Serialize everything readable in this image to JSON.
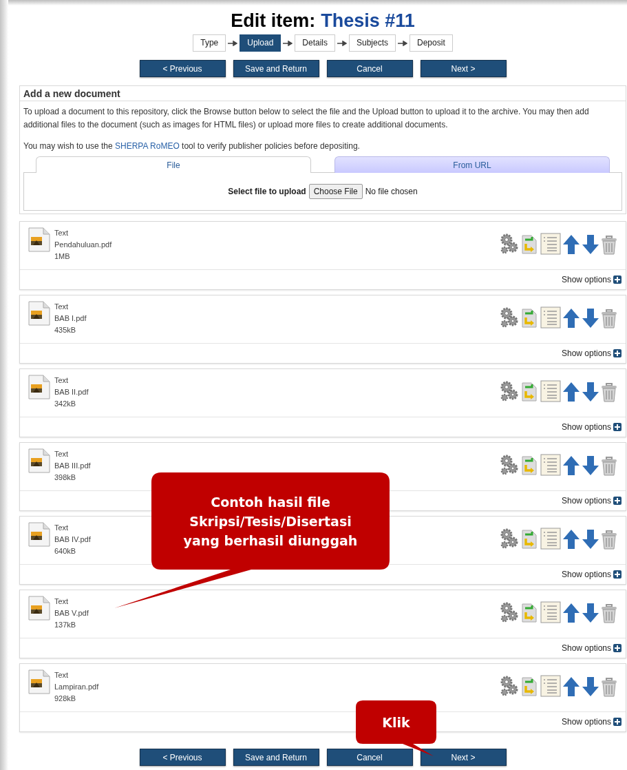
{
  "title": {
    "prefix": "Edit item:",
    "name": "Thesis #11"
  },
  "steps": [
    {
      "label": "Type",
      "selected": false
    },
    {
      "label": "Upload",
      "selected": true
    },
    {
      "label": "Details",
      "selected": false
    },
    {
      "label": "Subjects",
      "selected": false
    },
    {
      "label": "Deposit",
      "selected": false
    }
  ],
  "nav_buttons": [
    "< Previous",
    "Save and Return",
    "Cancel",
    "Next >"
  ],
  "add_document": {
    "heading": "Add a new document",
    "intro": "To upload a document to this repository, click the Browse button below to select the file and the Upload button to upload it to the archive. You may then add additional files to the document (such as images for HTML files) or upload more files to create additional documents.",
    "romeo_before": "You may wish to use the",
    "romeo_link": "SHERPA RoMEO",
    "romeo_after": "tool to verify publisher policies before depositing.",
    "tabs": [
      {
        "label": "File",
        "selected": true
      },
      {
        "label": "From URL",
        "selected": false
      }
    ],
    "file_label": "Select file to upload",
    "file_button": "Choose File",
    "file_status": "No file chosen"
  },
  "documents": [
    {
      "type": "Text",
      "filename": "Pendahuluan.pdf",
      "size": "1MB",
      "options": "Show options"
    },
    {
      "type": "Text",
      "filename": "BAB I.pdf",
      "size": "435kB",
      "options": "Show options"
    },
    {
      "type": "Text",
      "filename": "BAB II.pdf",
      "size": "342kB",
      "options": "Show options"
    },
    {
      "type": "Text",
      "filename": "BAB III.pdf",
      "size": "398kB",
      "options": "Show options"
    },
    {
      "type": "Text",
      "filename": "BAB IV.pdf",
      "size": "640kB",
      "options": "Show options"
    },
    {
      "type": "Text",
      "filename": "BAB V.pdf",
      "size": "137kB",
      "options": "Show options"
    },
    {
      "type": "Text",
      "filename": "Lampiran.pdf",
      "size": "928kB",
      "options": "Show options"
    }
  ],
  "bottom_buttons": [
    "< Previous",
    "Save and Return",
    "Cancel",
    "Next >"
  ],
  "callouts": [
    {
      "text": "Contoh hasil file\nSkripsi/Tesis/Disertasi\nyang berhasil diunggah",
      "kind": "large"
    },
    {
      "text": "Klik",
      "kind": "small"
    }
  ]
}
